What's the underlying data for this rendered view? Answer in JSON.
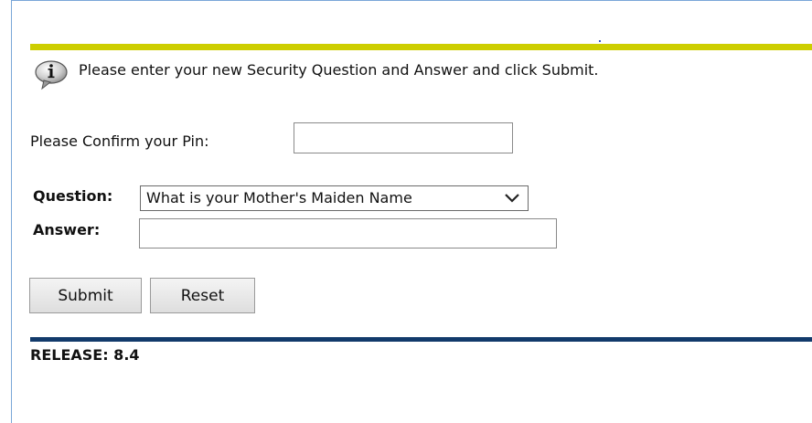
{
  "info": {
    "icon": "info-icon",
    "message": "Please enter your new Security Question and Answer and click Submit."
  },
  "pin": {
    "label": "Please Confirm your Pin:",
    "value": ""
  },
  "question": {
    "label": "Question:",
    "selected": "What is your Mother's Maiden Name"
  },
  "answer": {
    "label": "Answer:",
    "value": ""
  },
  "buttons": {
    "submit": "Submit",
    "reset": "Reset"
  },
  "footer": {
    "release": "RELEASE: 8.4"
  },
  "colors": {
    "top_bar": "#cdce00",
    "bottom_bar": "#123a6b",
    "frame": "#7aa7d8"
  }
}
